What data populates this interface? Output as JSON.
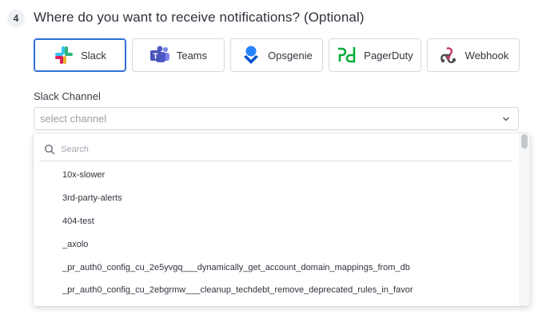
{
  "step": {
    "number": "4",
    "title": "Where do you want to receive notifications? (Optional)"
  },
  "providers": [
    {
      "label": "Slack",
      "icon": "slack-icon",
      "selected": true
    },
    {
      "label": "Teams",
      "icon": "teams-icon",
      "selected": false
    },
    {
      "label": "Opsgenie",
      "icon": "opsgenie-icon",
      "selected": false
    },
    {
      "label": "PagerDuty",
      "icon": "pagerduty-icon",
      "selected": false
    },
    {
      "label": "Webhook",
      "icon": "webhook-icon",
      "selected": false
    }
  ],
  "channel": {
    "label": "Slack Channel",
    "placeholder": "select channel",
    "search_placeholder": "Search",
    "options": [
      "10x-slower",
      "3rd-party-alerts",
      "404-test",
      "_axolo",
      "_pr_auth0_config_cu_2e5yvgq___dynamically_get_account_domain_mappings_from_db",
      "_pr_auth0_config_cu_2ebgrmw___cleanup_techdebt_remove_deprecated_rules_in_favor"
    ]
  },
  "colors": {
    "accent": "#2f6fd6",
    "border": "#d5d9df",
    "pagerduty_green": "#06ac38",
    "opsgenie_blue": "#2684ff",
    "teams_purple": "#5059c9"
  }
}
